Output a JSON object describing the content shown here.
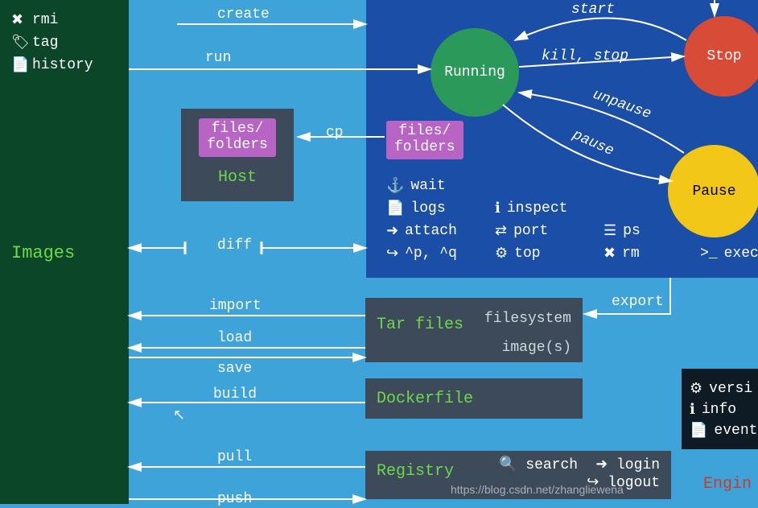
{
  "sidebar": {
    "items": [
      {
        "icon": "✖",
        "label": "rmi"
      },
      {
        "icon": "🏷",
        "label": "tag"
      },
      {
        "icon": "📄",
        "label": "history"
      }
    ],
    "heading": "Images"
  },
  "states": {
    "running": "Running",
    "stop": "Stop",
    "pause": "Pause"
  },
  "transitions": {
    "create": "create",
    "run": "run",
    "start": "start",
    "kill_stop": "kill, stop",
    "unpause": "unpause",
    "pause": "pause",
    "cp": "cp",
    "diff": "diff",
    "import": "import",
    "load": "load",
    "save": "save",
    "build": "build",
    "pull": "pull",
    "push": "push",
    "export": "export"
  },
  "host": {
    "folder_label": "files/\nfolders",
    "title": "Host"
  },
  "container_files": "files/\nfolders",
  "container_cmds": [
    {
      "icon": "⚓",
      "label": "wait"
    },
    {
      "icon": "📄",
      "label": "logs"
    },
    {
      "icon": "ℹ",
      "label": "inspect"
    },
    {
      "icon": "➜",
      "label": "attach"
    },
    {
      "icon": "⇄",
      "label": "port"
    },
    {
      "icon": "☰",
      "label": "ps"
    },
    {
      "icon": "↪",
      "label": "^p, ^q"
    },
    {
      "icon": "⚙",
      "label": "top"
    },
    {
      "icon": "✖",
      "label": "rm"
    },
    {
      "icon": ">_",
      "label": "exec"
    }
  ],
  "tar": {
    "title": "Tar files",
    "filesystem": "filesystem",
    "images": "image(s)"
  },
  "dockerfile": {
    "title": "Dockerfile"
  },
  "registry": {
    "title": "Registry",
    "cmds": [
      {
        "icon": "🔍",
        "label": "search"
      },
      {
        "icon": "➜",
        "label": "login"
      },
      {
        "icon": "↪",
        "label": "logout"
      }
    ]
  },
  "engine": {
    "items": [
      {
        "icon": "⚙",
        "label": "versi"
      },
      {
        "icon": "ℹ",
        "label": "info"
      },
      {
        "icon": "📄",
        "label": "event"
      }
    ],
    "title": "Engin"
  },
  "watermark": "https://blog.csdn.net/zhangliewena"
}
